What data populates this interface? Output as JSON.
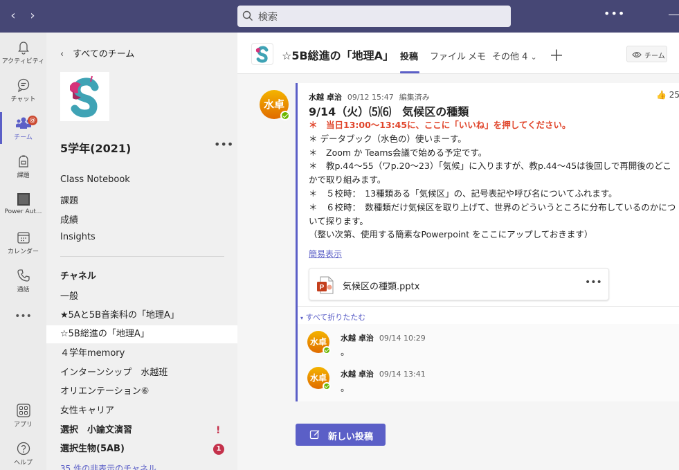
{
  "topbar": {
    "search_placeholder": "検索",
    "more": "•••"
  },
  "rail": [
    {
      "label": "アクティビティ",
      "icon": "bell-icon"
    },
    {
      "label": "チャット",
      "icon": "chat-icon"
    },
    {
      "label": "チーム",
      "icon": "teams-icon",
      "badge": "@"
    },
    {
      "label": "課題",
      "icon": "assignments-icon"
    },
    {
      "label": "Power Aut...",
      "icon": "power-automate-icon"
    },
    {
      "label": "カレンダー",
      "icon": "calendar-icon"
    },
    {
      "label": "通話",
      "icon": "phone-icon"
    },
    {
      "label": "•••",
      "icon": "more-apps-icon"
    },
    {
      "label": "アプリ",
      "icon": "apps-icon"
    },
    {
      "label": "ヘルプ",
      "icon": "help-icon"
    }
  ],
  "team_panel": {
    "back_label": "すべてのチーム",
    "team_name": "5学年(2021)",
    "more": "•••",
    "links": [
      "Class Notebook",
      "課題",
      "成績",
      "Insights"
    ],
    "channels_heading": "チャネル",
    "channels": [
      {
        "name": "一般"
      },
      {
        "name": "★5Aと5B音楽科の「地理A」"
      },
      {
        "name": "☆5B総進の「地理A」"
      },
      {
        "name": "４学年memory"
      },
      {
        "name": "インターンシップ　水越班"
      },
      {
        "name": "オリエンテーション⑥"
      },
      {
        "name": "女性キャリア"
      },
      {
        "name": "選択　小論文演習",
        "alert": "!"
      },
      {
        "name": "選択生物(5AB)",
        "badge": "1"
      }
    ],
    "hidden_channels": "35 件の非表示のチャネル"
  },
  "main": {
    "channel_title": "☆5B総進の「地理A」",
    "tabs": [
      "投稿",
      "ファイル",
      "メモ",
      "その他 4"
    ],
    "tab_more_chevron": "⌄",
    "plus": "＋",
    "team_button": "チーム",
    "post": {
      "avatar_text": "水卓",
      "author": "水越 卓治",
      "timestamp": "09/12 15:47",
      "edited": "編集済み",
      "likes": "25",
      "title": "9/14（火）⑸⑹　気候区の種類",
      "lines": [
        {
          "text": "＊　当日13:00～13:45に、ここに「いいね」を押してください。",
          "style": "red"
        },
        {
          "text": "＊ データブック（水色の）使いまーす。"
        },
        {
          "text": "＊　Zoom か Teams会議で始める予定です。"
        },
        {
          "text": "＊　教p.44～55（ワp.20～23）「気候」に入りますが、教p.44～45は後回しで再開後のどこかで取り組みます。"
        },
        {
          "text": "＊　５校時：　13種類ある「気候区」の、記号表記や呼び名についてふれます。"
        },
        {
          "text": "＊　６校時：　数種類だけ気候区を取り上げて、世界のどういうところに分布しているのかについて探ります。"
        },
        {
          "text": "（整い次第、使用する簡素なPowerpoint をここにアップしておきます）"
        }
      ],
      "compact_link": "簡易表示",
      "attachment": {
        "name": "気候区の種類.pptx",
        "icon": "powerpoint-file-icon",
        "more": "•••"
      },
      "collapse_all": "すべて折りたたむ",
      "replies": [
        {
          "avatar_text": "水卓",
          "author": "水越 卓治",
          "timestamp": "09/14 10:29",
          "text": "。"
        },
        {
          "avatar_text": "水卓",
          "author": "水越 卓治",
          "timestamp": "09/14 13:41",
          "text": "。"
        }
      ]
    },
    "new_post_button": "新しい投稿"
  },
  "colors": {
    "titlebar": "#464775",
    "accent": "#5b5fc7",
    "emphasis_red": "#e0452b",
    "badge_red": "#c4314b"
  }
}
